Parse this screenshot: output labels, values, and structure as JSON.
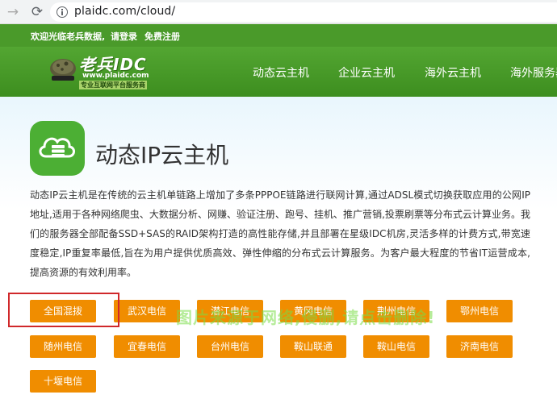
{
  "browser": {
    "url": "plaidc.com/cloud/"
  },
  "top_strip": {
    "welcome": "欢迎光临老兵数据,",
    "login": "请登录",
    "register": "免费注册"
  },
  "logo": {
    "title": "老兵IDC",
    "url": "www.plaidc.com",
    "slogan": "专业互联网平台服务商"
  },
  "nav": {
    "items": [
      "动态云主机",
      "企业云主机",
      "海外云主机",
      "海外服务器"
    ]
  },
  "main": {
    "title": "动态IP云主机",
    "description": "动态IP云主机是在传统的云主机单链路上增加了多条PPPOE链路进行联网计算,通过ADSL模式切换获取应用的公网IP地址,适用于各种网络爬虫、大数据分析、网赚、验证注册、跑号、挂机、推广营销,投票刷票等分布式云计算业务。我们的服务器全部配备SSD+SAS的RAID架构打造的高性能存储,并且部署在星级IDC机房,灵活多样的计费方式,带宽速度稳定,IP重复率最低,旨在为用户提供优质高效、弹性伸缩的分布式云计算服务。为客户最大程度的节省IT运营成本,提高资源的有效利用率。"
  },
  "regions": [
    "全国混拨",
    "武汉电信",
    "潜江电信",
    "黄冈电信",
    "荆州电信",
    "鄂州电信",
    "随州电信",
    "宜春电信",
    "台州电信",
    "鞍山联通",
    "鞍山电信",
    "济南电信",
    "十堰电信"
  ],
  "watermark": "图片来源于网络,侵删,请点击删除!",
  "colors": {
    "brand_green": "#4a9a2a",
    "button_orange": "#f08d00",
    "highlight_red": "#d0282a"
  }
}
